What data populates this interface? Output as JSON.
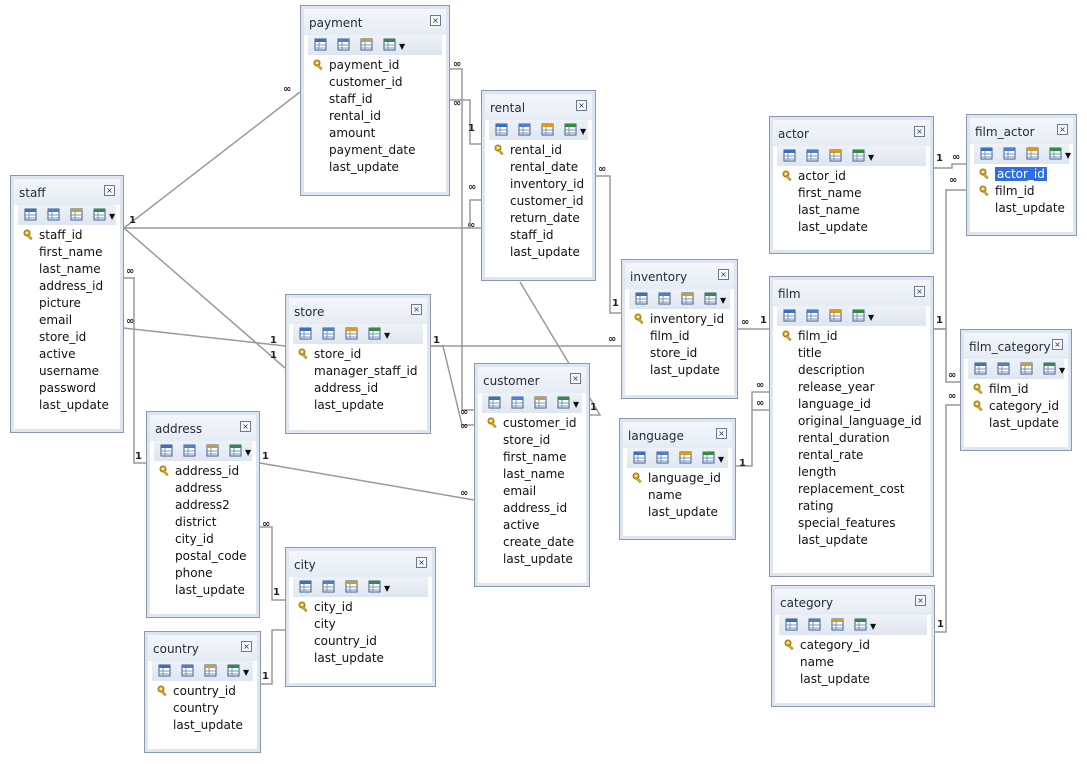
{
  "colors": {
    "window_border": "#8b98ab",
    "header_bg": "#e6ecf4",
    "selection": "#2f6ee0",
    "relation_line": "#9a9a9a",
    "key_icon": "#d9a520"
  },
  "cardinality": {
    "one": "1",
    "many": "∞"
  },
  "tables": [
    {
      "name": "staff",
      "close_icon": "×",
      "fields": [
        {
          "name": "staff_id",
          "key": true
        },
        {
          "name": "first_name"
        },
        {
          "name": "last_name"
        },
        {
          "name": "address_id"
        },
        {
          "name": "picture"
        },
        {
          "name": "email"
        },
        {
          "name": "store_id"
        },
        {
          "name": "active"
        },
        {
          "name": "username"
        },
        {
          "name": "password"
        },
        {
          "name": "last_update"
        }
      ]
    },
    {
      "name": "payment",
      "close_icon": "×",
      "fields": [
        {
          "name": "payment_id",
          "key": true
        },
        {
          "name": "customer_id"
        },
        {
          "name": "staff_id"
        },
        {
          "name": "rental_id"
        },
        {
          "name": "amount"
        },
        {
          "name": "payment_date"
        },
        {
          "name": "last_update"
        }
      ]
    },
    {
      "name": "rental",
      "close_icon": "×",
      "fields": [
        {
          "name": "rental_id",
          "key": true
        },
        {
          "name": "rental_date"
        },
        {
          "name": "inventory_id"
        },
        {
          "name": "customer_id"
        },
        {
          "name": "return_date"
        },
        {
          "name": "staff_id"
        },
        {
          "name": "last_update"
        }
      ]
    },
    {
      "name": "store",
      "close_icon": "×",
      "fields": [
        {
          "name": "store_id",
          "key": true
        },
        {
          "name": "manager_staff_id"
        },
        {
          "name": "address_id"
        },
        {
          "name": "last_update"
        }
      ]
    },
    {
      "name": "customer",
      "close_icon": "×",
      "fields": [
        {
          "name": "customer_id",
          "key": true
        },
        {
          "name": "store_id"
        },
        {
          "name": "first_name"
        },
        {
          "name": "last_name"
        },
        {
          "name": "email"
        },
        {
          "name": "address_id"
        },
        {
          "name": "active"
        },
        {
          "name": "create_date"
        },
        {
          "name": "last_update"
        }
      ]
    },
    {
      "name": "address",
      "close_icon": "×",
      "fields": [
        {
          "name": "address_id",
          "key": true
        },
        {
          "name": "address"
        },
        {
          "name": "address2"
        },
        {
          "name": "district"
        },
        {
          "name": "city_id"
        },
        {
          "name": "postal_code"
        },
        {
          "name": "phone"
        },
        {
          "name": "last_update"
        }
      ]
    },
    {
      "name": "city",
      "close_icon": "×",
      "fields": [
        {
          "name": "city_id",
          "key": true
        },
        {
          "name": "city"
        },
        {
          "name": "country_id"
        },
        {
          "name": "last_update"
        }
      ]
    },
    {
      "name": "country",
      "close_icon": "×",
      "fields": [
        {
          "name": "country_id",
          "key": true
        },
        {
          "name": "country"
        },
        {
          "name": "last_update"
        }
      ]
    },
    {
      "name": "inventory",
      "close_icon": "×",
      "fields": [
        {
          "name": "inventory_id",
          "key": true
        },
        {
          "name": "film_id"
        },
        {
          "name": "store_id"
        },
        {
          "name": "last_update"
        }
      ]
    },
    {
      "name": "language",
      "close_icon": "×",
      "fields": [
        {
          "name": "language_id",
          "key": true
        },
        {
          "name": "name"
        },
        {
          "name": "last_update"
        }
      ]
    },
    {
      "name": "actor",
      "close_icon": "×",
      "fields": [
        {
          "name": "actor_id",
          "key": true
        },
        {
          "name": "first_name"
        },
        {
          "name": "last_name"
        },
        {
          "name": "last_update"
        }
      ]
    },
    {
      "name": "film",
      "close_icon": "×",
      "fields": [
        {
          "name": "film_id",
          "key": true
        },
        {
          "name": "title"
        },
        {
          "name": "description"
        },
        {
          "name": "release_year"
        },
        {
          "name": "language_id"
        },
        {
          "name": "original_language_id"
        },
        {
          "name": "rental_duration"
        },
        {
          "name": "rental_rate"
        },
        {
          "name": "length"
        },
        {
          "name": "replacement_cost"
        },
        {
          "name": "rating"
        },
        {
          "name": "special_features"
        },
        {
          "name": "last_update"
        }
      ]
    },
    {
      "name": "category",
      "close_icon": "×",
      "fields": [
        {
          "name": "category_id",
          "key": true
        },
        {
          "name": "name"
        },
        {
          "name": "last_update"
        }
      ]
    },
    {
      "name": "film_actor",
      "close_icon": "×",
      "fields": [
        {
          "name": "actor_id",
          "key": true,
          "selected": true
        },
        {
          "name": "film_id",
          "key": true
        },
        {
          "name": "last_update"
        }
      ]
    },
    {
      "name": "film_category",
      "close_icon": "×",
      "fields": [
        {
          "name": "film_id",
          "key": true
        },
        {
          "name": "category_id",
          "key": true
        },
        {
          "name": "last_update"
        }
      ]
    }
  ]
}
